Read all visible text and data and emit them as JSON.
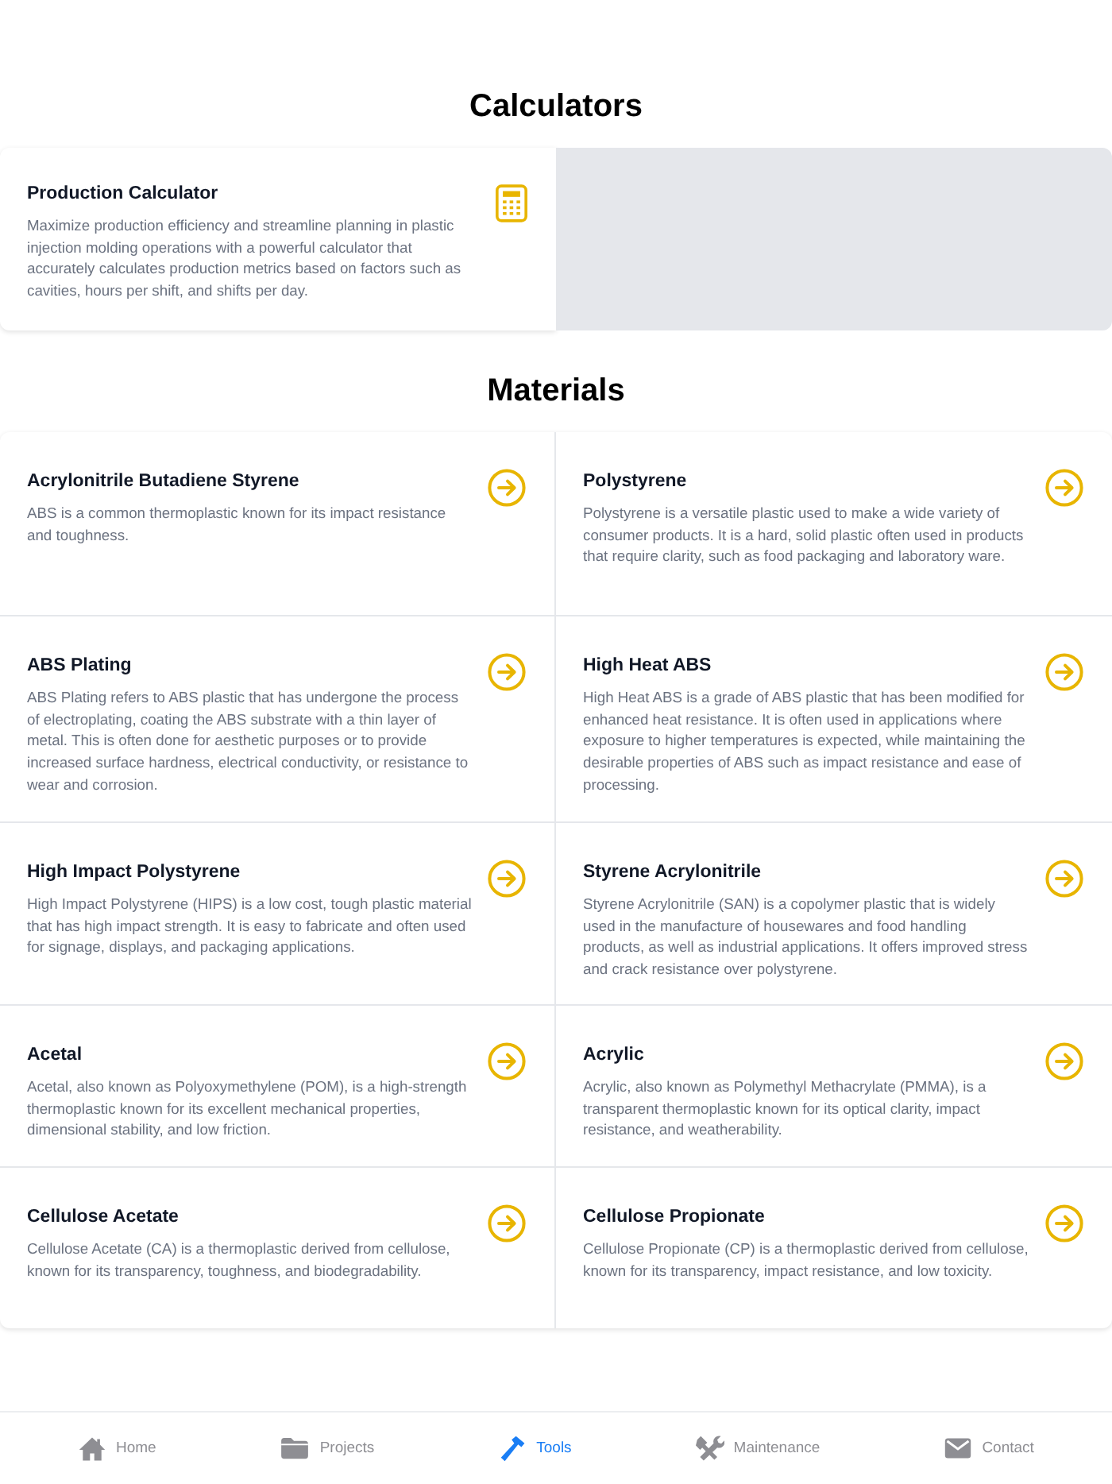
{
  "calculators": {
    "title": "Calculators",
    "items": [
      {
        "title": "Production Calculator",
        "description": "Maximize production efficiency and streamline planning in plastic injection molding operations with a powerful calculator that accurately calculates production metrics based on factors such as cavities, hours per shift, and shifts per day."
      }
    ]
  },
  "materials": {
    "title": "Materials",
    "items": [
      {
        "title": "Acrylonitrile Butadiene Styrene",
        "description": "ABS is a common thermoplastic known for its impact resistance and toughness."
      },
      {
        "title": "Polystyrene",
        "description": "Polystyrene is a versatile plastic used to make a wide variety of consumer products. It is a hard, solid plastic often used in products that require clarity, such as food packaging and laboratory ware."
      },
      {
        "title": "ABS Plating",
        "description": "ABS Plating refers to ABS plastic that has undergone the process of electroplating, coating the ABS substrate with a thin layer of metal. This is often done for aesthetic purposes or to provide increased surface hardness, electrical conductivity, or resistance to wear and corrosion."
      },
      {
        "title": "High Heat ABS",
        "description": "High Heat ABS is a grade of ABS plastic that has been modified for enhanced heat resistance. It is often used in applications where exposure to higher temperatures is expected, while maintaining the desirable properties of ABS such as impact resistance and ease of processing."
      },
      {
        "title": "High Impact Polystyrene",
        "description": "High Impact Polystyrene (HIPS) is a low cost, tough plastic material that has high impact strength. It is easy to fabricate and often used for signage, displays, and packaging applications."
      },
      {
        "title": "Styrene Acrylonitrile",
        "description": "Styrene Acrylonitrile (SAN) is a copolymer plastic that is widely used in the manufacture of housewares and food handling products, as well as industrial applications. It offers improved stress and crack resistance over polystyrene."
      },
      {
        "title": "Acetal",
        "description": "Acetal, also known as Polyoxymethylene (POM), is a high-strength thermoplastic known for its excellent mechanical properties, dimensional stability, and low friction."
      },
      {
        "title": "Acrylic",
        "description": "Acrylic, also known as Polymethyl Methacrylate (PMMA), is a transparent thermoplastic known for its optical clarity, impact resistance, and weatherability."
      },
      {
        "title": "Cellulose Acetate",
        "description": "Cellulose Acetate (CA) is a thermoplastic derived from cellulose, known for its transparency, toughness, and biodegradability."
      },
      {
        "title": "Cellulose Propionate",
        "description": "Cellulose Propionate (CP) is a thermoplastic derived from cellulose, known for its transparency, impact resistance, and low toxicity."
      }
    ]
  },
  "tab_bar": [
    {
      "label": "Home",
      "kind": "home",
      "selected": false
    },
    {
      "label": "Projects",
      "kind": "folder",
      "selected": false
    },
    {
      "label": "Tools",
      "kind": "hammer",
      "selected": true
    },
    {
      "label": "Maintenance",
      "kind": "wrench",
      "selected": false
    },
    {
      "label": "Contact",
      "kind": "mail",
      "selected": false
    }
  ]
}
